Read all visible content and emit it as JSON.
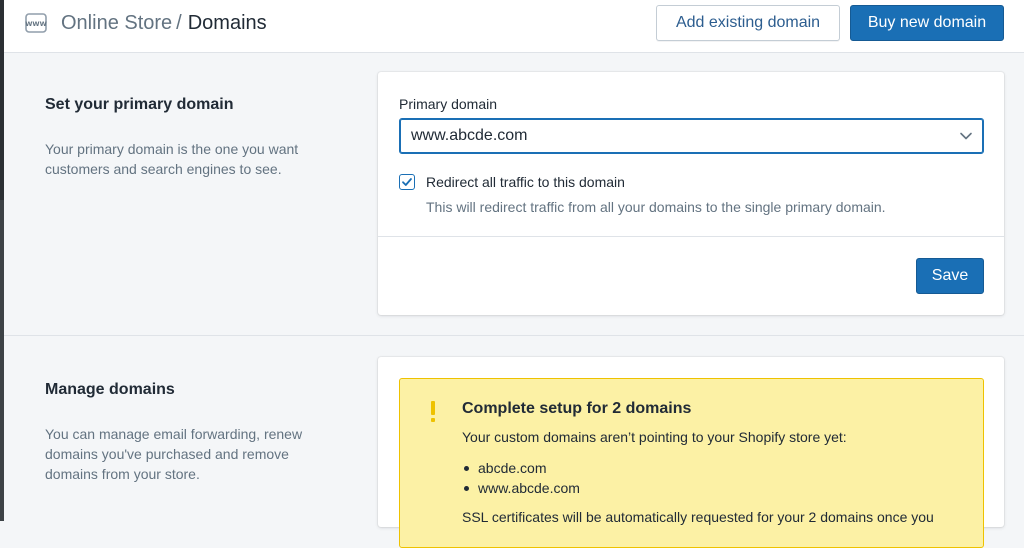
{
  "header": {
    "breadcrumb_parent": "Online Store",
    "breadcrumb_separator": "/",
    "page_title": "Domains",
    "add_existing_label": "Add existing domain",
    "buy_new_label": "Buy new domain",
    "icon": "www-icon"
  },
  "primary_section": {
    "title": "Set your primary domain",
    "description": "Your primary domain is the one you want customers and search engines to see.",
    "field_label": "Primary domain",
    "selected_domain": "www.abcde.com",
    "redirect_checked": true,
    "redirect_label": "Redirect all traffic to this domain",
    "redirect_help": "This will redirect traffic from all your domains to the single primary domain.",
    "save_label": "Save"
  },
  "manage_section": {
    "title": "Manage domains",
    "description": "You can manage email forwarding, renew domains you've purchased and remove domains from your store.",
    "banner": {
      "title": "Complete setup for 2 domains",
      "text": "Your custom domains aren’t pointing to your Shopify store yet:",
      "domains": [
        "abcde.com",
        "www.abcde.com"
      ],
      "text2": "SSL certificates will be automatically requested for your 2 domains once you"
    }
  },
  "colors": {
    "accent": "#1a6fb5",
    "banner_bg": "#fcf1a5",
    "banner_border": "#eec200",
    "warning_icon": "#eec200"
  }
}
